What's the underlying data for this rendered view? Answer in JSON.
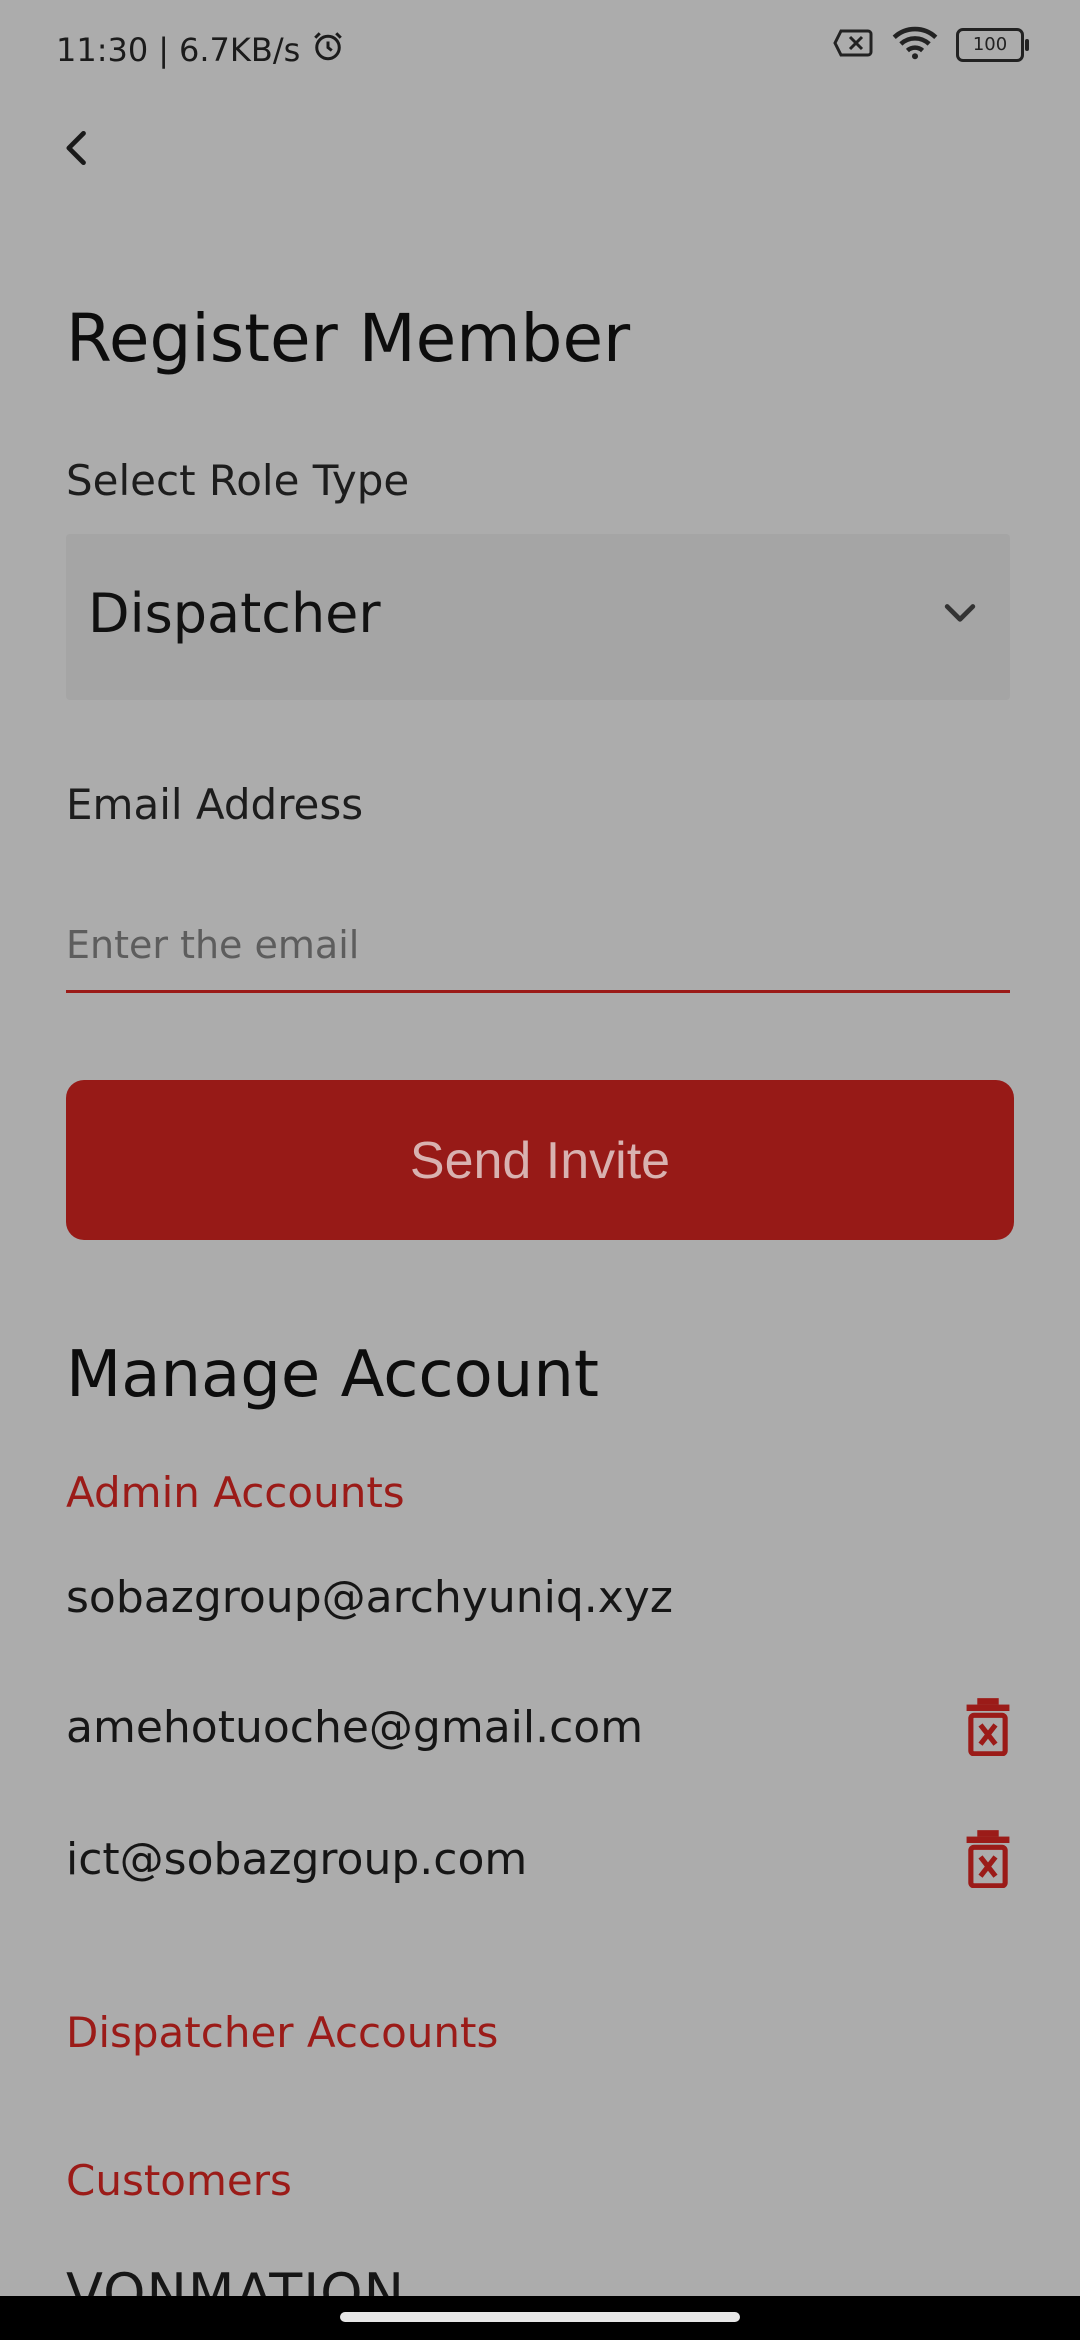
{
  "status": {
    "time": "11:30",
    "network_speed": "6.7KB/s",
    "battery": "100",
    "icons": [
      "alarm-icon",
      "sim-off-icon",
      "wifi-icon",
      "battery-icon"
    ]
  },
  "header": {
    "back_icon": "chevron-left-icon"
  },
  "form": {
    "title": "Register Member",
    "role_label": "Select Role Type",
    "role_value": "Dispatcher",
    "email_label": "Email Address",
    "email_placeholder": "Enter the email",
    "email_value": "",
    "send_label": "Send Invite"
  },
  "manage": {
    "title": "Manage Account",
    "admin_title": "Admin Accounts",
    "admin_accounts": [
      {
        "email": "sobazgroup@archyuniq.xyz"
      },
      {
        "email": "amehotuoche@gmail.com"
      },
      {
        "email": "ict@sobazgroup.com"
      }
    ],
    "dispatcher_title": "Dispatcher Accounts",
    "customers_title": "Customers",
    "customers_first": "VONMATION"
  },
  "colors": {
    "background": "#acacac",
    "accent": "#9b1b18",
    "button": "#971a17",
    "button_text": "#d8b2b0"
  }
}
